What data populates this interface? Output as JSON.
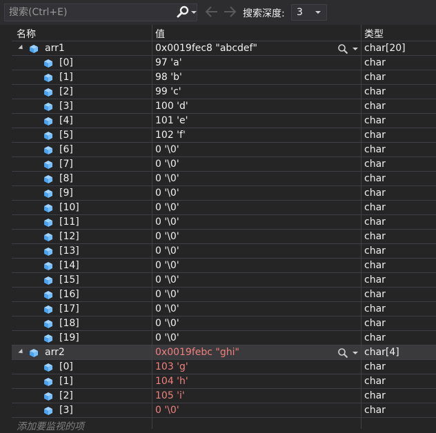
{
  "toolbar": {
    "search_placeholder": "搜索(Ctrl+E)",
    "depth_label": "搜索深度:",
    "depth_value": "3"
  },
  "columns": {
    "name": "名称",
    "value": "值",
    "type": "类型"
  },
  "arr1": {
    "name": "arr1",
    "value": "0x0019fec8 \"abcdef\"",
    "type": "char[20]",
    "items": [
      {
        "name": "[0]",
        "value": "97 'a'",
        "type": "char"
      },
      {
        "name": "[1]",
        "value": "98 'b'",
        "type": "char"
      },
      {
        "name": "[2]",
        "value": "99 'c'",
        "type": "char"
      },
      {
        "name": "[3]",
        "value": "100 'd'",
        "type": "char"
      },
      {
        "name": "[4]",
        "value": "101 'e'",
        "type": "char"
      },
      {
        "name": "[5]",
        "value": "102 'f'",
        "type": "char"
      },
      {
        "name": "[6]",
        "value": "0 '\\0'",
        "type": "char"
      },
      {
        "name": "[7]",
        "value": "0 '\\0'",
        "type": "char"
      },
      {
        "name": "[8]",
        "value": "0 '\\0'",
        "type": "char"
      },
      {
        "name": "[9]",
        "value": "0 '\\0'",
        "type": "char"
      },
      {
        "name": "[10]",
        "value": "0 '\\0'",
        "type": "char"
      },
      {
        "name": "[11]",
        "value": "0 '\\0'",
        "type": "char"
      },
      {
        "name": "[12]",
        "value": "0 '\\0'",
        "type": "char"
      },
      {
        "name": "[13]",
        "value": "0 '\\0'",
        "type": "char"
      },
      {
        "name": "[14]",
        "value": "0 '\\0'",
        "type": "char"
      },
      {
        "name": "[15]",
        "value": "0 '\\0'",
        "type": "char"
      },
      {
        "name": "[16]",
        "value": "0 '\\0'",
        "type": "char"
      },
      {
        "name": "[17]",
        "value": "0 '\\0'",
        "type": "char"
      },
      {
        "name": "[18]",
        "value": "0 '\\0'",
        "type": "char"
      },
      {
        "name": "[19]",
        "value": "0 '\\0'",
        "type": "char"
      }
    ]
  },
  "arr2": {
    "name": "arr2",
    "value": "0x0019febc \"ghi\"",
    "type": "char[4]",
    "items": [
      {
        "name": "[0]",
        "value": "103 'g'",
        "type": "char"
      },
      {
        "name": "[1]",
        "value": "104 'h'",
        "type": "char"
      },
      {
        "name": "[2]",
        "value": "105 'i'",
        "type": "char"
      },
      {
        "name": "[3]",
        "value": "0 '\\0'",
        "type": "char"
      }
    ]
  },
  "add_watch_text": "添加要监视的项",
  "colors": {
    "changed_value": "#f1807f",
    "cube_icon": "#75beff"
  }
}
